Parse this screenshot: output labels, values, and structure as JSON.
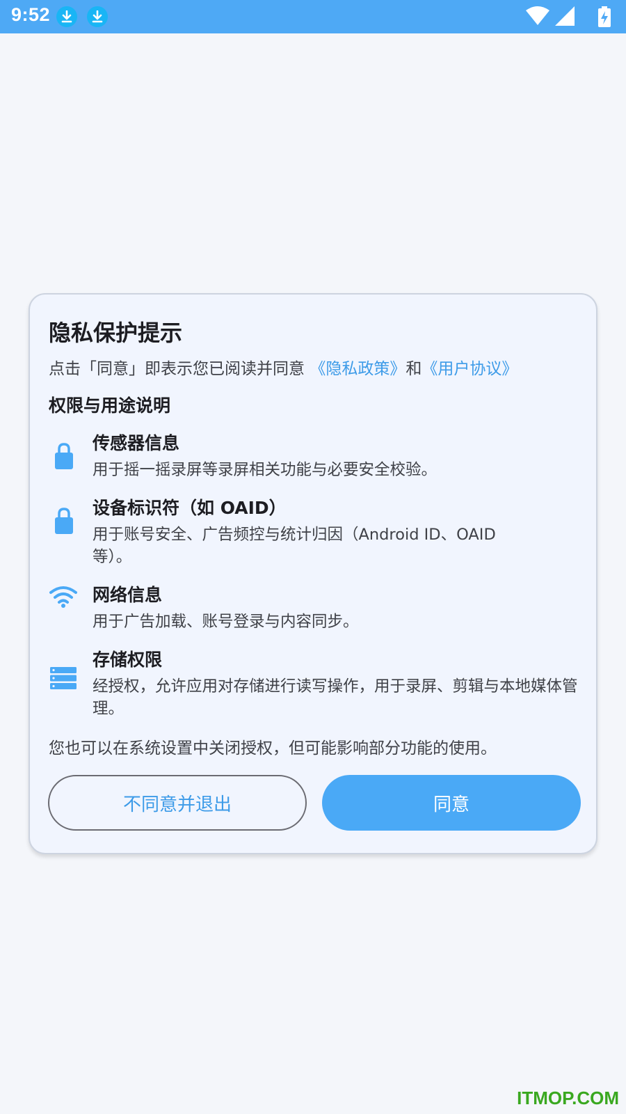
{
  "status_bar": {
    "time": "9:52",
    "left_icons": [
      "download-icon",
      "download-icon"
    ],
    "right_icons": [
      "wifi-icon",
      "cellular-signal-icon",
      "battery-charging-icon"
    ],
    "background_color": "#4ea9f5"
  },
  "dialog": {
    "title": "隐私保护提示",
    "consent_prefix": "点击「同意」即表示您已阅读并同意 ",
    "privacy_policy_link": "《隐私政策》",
    "conjunction": "和",
    "user_agreement_link": "《用户协议》",
    "section_heading": "权限与用途说明",
    "permissions": [
      {
        "icon": "lock-icon",
        "title": "传感器信息",
        "description": "用于摇一摇录屏等录屏相关功能与必要安全校验。"
      },
      {
        "icon": "lock-icon",
        "title": "设备标识符（如 OAID）",
        "description": "用于账号安全、广告频控与统计归因（Android ID、OAID 等）。"
      },
      {
        "icon": "wifi-icon",
        "title": "网络信息",
        "description": "用于广告加载、账号登录与内容同步。"
      },
      {
        "icon": "storage-icon",
        "title": "存储权限",
        "description": "经授权，允许应用对存储进行读写操作，用于录屏、剪辑与本地媒体管理。"
      }
    ],
    "footnote": "您也可以在系统设置中关闭授权，但可能影响部分功能的使用。",
    "decline_button": "不同意并退出",
    "agree_button": "同意",
    "accent_color": "#4aa9f6",
    "link_color": "#3d9be8"
  },
  "watermark": "ITMOP.COM"
}
